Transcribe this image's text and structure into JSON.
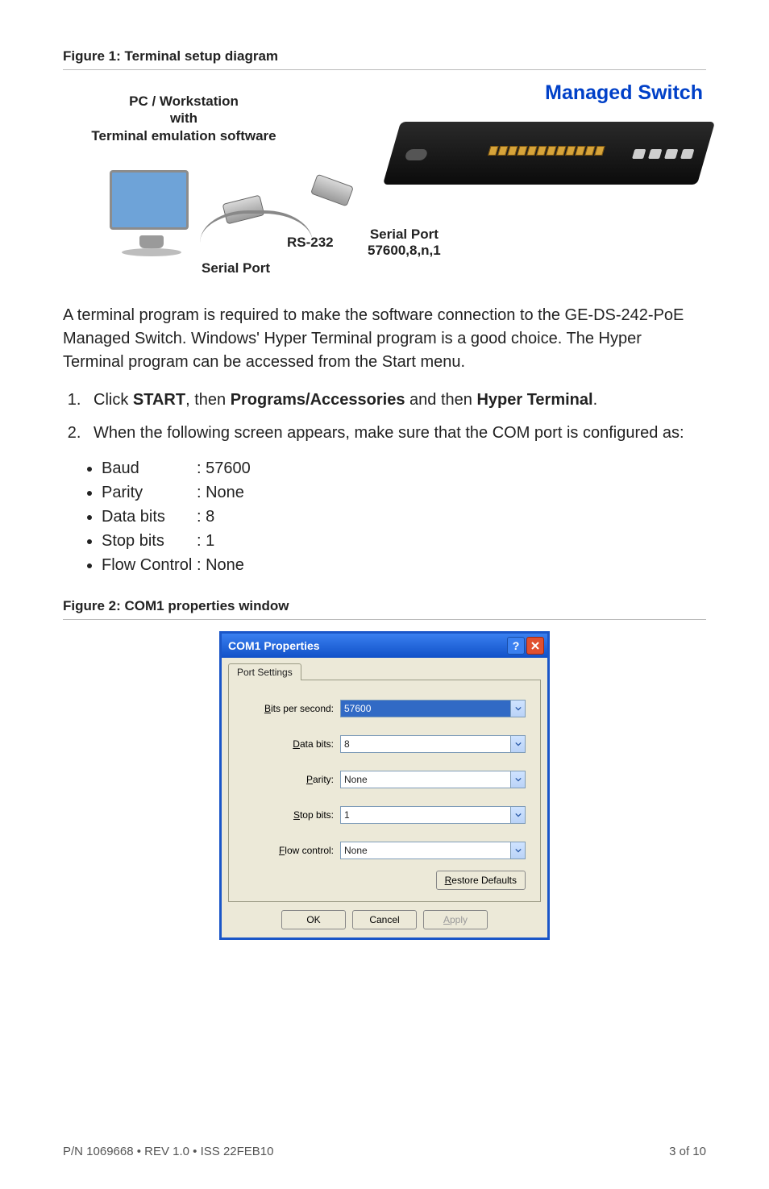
{
  "figure1": {
    "caption": "Figure 1: Terminal setup diagram",
    "pc_label": "PC / Workstation\nwith\nTerminal emulation software",
    "managed_switch": "Managed Switch",
    "rs232": "RS-232",
    "serial_port_left": "Serial Port",
    "serial_port_right_line1": "Serial Port",
    "serial_port_right_line2": "57600,8,n,1"
  },
  "body": {
    "para1": "A terminal program is required to make the software connection to the GE-DS-242-PoE Managed Switch. Windows' Hyper Terminal program is a good choice. The Hyper Terminal program can be accessed from the Start menu.",
    "step1_pre": "Click ",
    "step1_b1": "START",
    "step1_mid1": ", then ",
    "step1_b2": "Programs/Accessories",
    "step1_mid2": " and then ",
    "step1_b3": "Hyper Terminal",
    "step1_post": ".",
    "step2": "When the following screen appears, make sure that the COM port is configured as:",
    "params": [
      {
        "k": "Baud",
        "v": ": 57600"
      },
      {
        "k": "Parity",
        "v": ": None"
      },
      {
        "k": "Data bits",
        "v": ": 8"
      },
      {
        "k": "Stop bits",
        "v": ": 1"
      },
      {
        "k": "Flow Control",
        "v": ": None"
      }
    ]
  },
  "figure2": {
    "caption": "Figure 2: COM1 properties window"
  },
  "dialog": {
    "title": "COM1 Properties",
    "tab": "Port Settings",
    "rows": {
      "bits_per_second": {
        "label_u": "B",
        "label_rest": "its per second:",
        "value": "57600"
      },
      "data_bits": {
        "label_u": "D",
        "label_rest": "ata bits:",
        "value": "8"
      },
      "parity": {
        "label_u": "P",
        "label_rest": "arity:",
        "value": "None"
      },
      "stop_bits": {
        "label_u": "S",
        "label_rest": "top bits:",
        "value": "1"
      },
      "flow_control": {
        "label_u": "F",
        "label_rest": "low control:",
        "value": "None"
      }
    },
    "restore": "Restore Defaults",
    "ok": "OK",
    "cancel": "Cancel",
    "apply": "Apply"
  },
  "footer": {
    "left": "P/N 1069668 • REV 1.0 • ISS 22FEB10",
    "right": "3 of 10"
  }
}
